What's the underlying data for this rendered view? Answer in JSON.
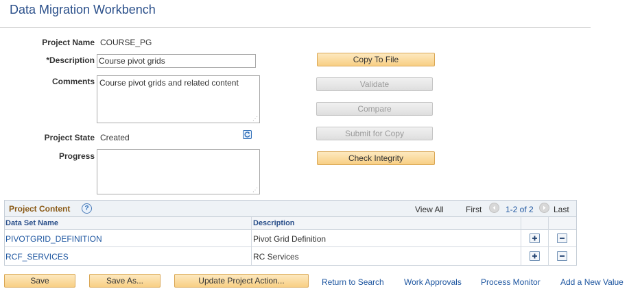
{
  "page": {
    "title": "Data Migration Workbench"
  },
  "form": {
    "project_name_label": "Project Name",
    "project_name_value": "COURSE_PG",
    "description_label": "*Description",
    "description_value": "Course pivot grids",
    "comments_label": "Comments",
    "comments_value": "Course pivot grids and related content",
    "project_state_label": "Project State",
    "project_state_value": "Created",
    "progress_label": "Progress",
    "progress_value": ""
  },
  "actions": {
    "copy_to_file": "Copy To File",
    "validate": "Validate",
    "compare": "Compare",
    "submit_for_copy": "Submit for Copy",
    "check_integrity": "Check Integrity"
  },
  "grid": {
    "title": "Project Content",
    "help": "?",
    "view_all": "View All",
    "first": "First",
    "range": "1-2 of 2",
    "last": "Last",
    "columns": {
      "data_set_name": "Data Set Name",
      "description": "Description"
    },
    "rows": [
      {
        "name": "PIVOTGRID_DEFINITION",
        "description": "Pivot Grid Definition"
      },
      {
        "name": "RCF_SERVICES",
        "description": "RC Services"
      }
    ]
  },
  "footer": {
    "save": "Save",
    "save_as": "Save As...",
    "update_project_action": "Update Project Action...",
    "return_to_search": "Return to Search",
    "work_approvals": "Work Approvals",
    "process_monitor": "Process Monitor",
    "add_new_value": "Add a New Value"
  },
  "colors": {
    "title": "#2a4f8a",
    "link": "#1e56a0",
    "grid_title": "#8a5a16",
    "button_fill": "#f8cf84",
    "button_border": "#d9a653"
  },
  "icons": [
    "refresh-icon",
    "help-icon",
    "arrow-left-icon",
    "arrow-right-icon",
    "plus-icon",
    "minus-icon"
  ]
}
